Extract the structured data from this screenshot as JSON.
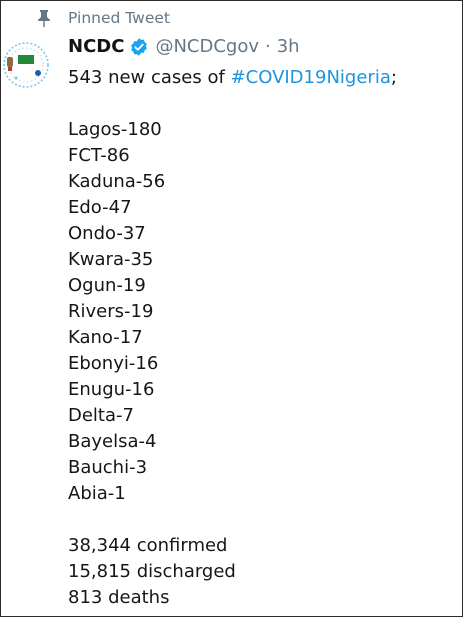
{
  "pinned": {
    "label": "Pinned Tweet",
    "icon": "pin-icon"
  },
  "author": {
    "name": "NCDC",
    "handle": "@NCDCgov",
    "separator": "·",
    "time": "3h",
    "verified_color": "#1da1f2",
    "avatar_text": "NCDC"
  },
  "tweet": {
    "intro": "543 new cases of ",
    "hashtag": "#COVID19Nigeria",
    "intro_end": ";",
    "states": [
      "Lagos-180",
      "FCT-86",
      "Kaduna-56",
      "Edo-47",
      "Ondo-37",
      "Kwara-35",
      "Ogun-19",
      "Rivers-19",
      "Kano-17",
      "Ebonyi-16",
      "Enugu-16",
      "Delta-7",
      "Bayelsa-4",
      "Bauchi-3",
      "Abia-1"
    ],
    "summary": [
      "38,344 confirmed",
      "15,815 discharged",
      "813 deaths"
    ]
  },
  "colors": {
    "hashtag": "#1b95e0",
    "muted": "#657786"
  }
}
